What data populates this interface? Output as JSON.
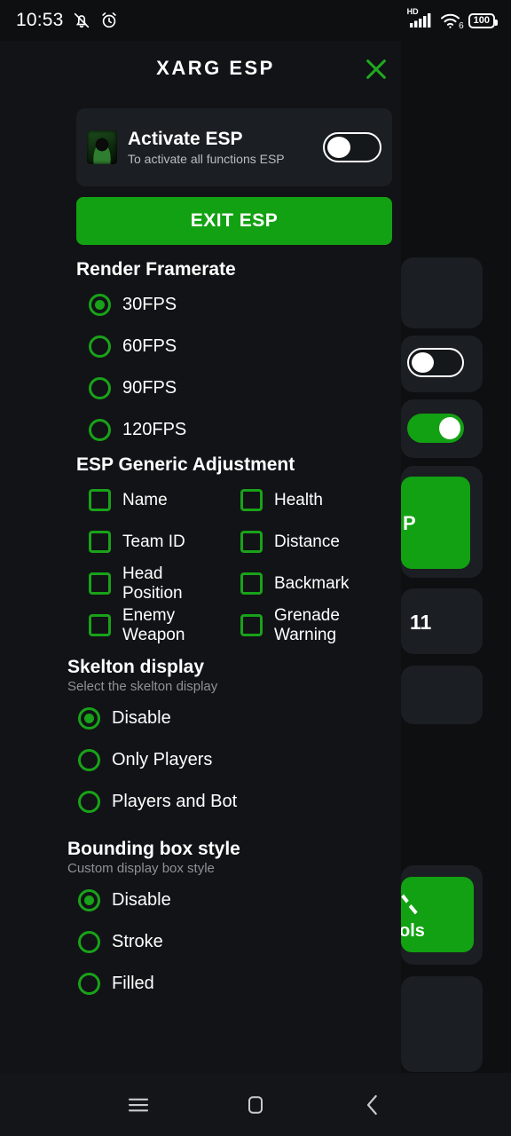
{
  "status_bar": {
    "time": "10:53",
    "icons_left": [
      "bell-muted-icon",
      "alarm-clock-icon"
    ],
    "network_label": "HD",
    "wifi_generation": "6",
    "battery_level": "100",
    "icons_right": [
      "hd-signal-icon",
      "wifi-6-icon",
      "battery-icon"
    ]
  },
  "theme": {
    "accent_green": "#12a112",
    "radio_green": "#19a219",
    "panel_bg": "#111316",
    "card_bg": "#1b1e22",
    "page_bg": "#0d0f11",
    "text_primary": "#ffffff",
    "text_secondary": "#8d9298"
  },
  "sidebar": {
    "items": [
      {
        "icon": "eye-icon",
        "active": true
      },
      {
        "icon": "location-pin-icon",
        "active": false
      },
      {
        "icon": "car-icon",
        "active": false
      },
      {
        "icon": "aim-target-icon",
        "active": false
      },
      {
        "icon": "gear-icon",
        "active": false
      },
      {
        "icon": "cpu-chip-icon",
        "active": false
      }
    ]
  },
  "panel": {
    "title": "XARG ESP",
    "close_icon": "close-icon",
    "activate_card": {
      "avatar_icon": "app-logo-avatar",
      "title": "Activate ESP",
      "subtitle": "To activate all functions ESP",
      "toggle_state": "off"
    },
    "exit_button": "EXIT ESP",
    "sections": [
      {
        "id": "render-framerate",
        "title": "Render Framerate",
        "subtitle": "",
        "type": "radio",
        "options": [
          {
            "label": "30FPS",
            "selected": true
          },
          {
            "label": "60FPS",
            "selected": false
          },
          {
            "label": "90FPS",
            "selected": false
          },
          {
            "label": "120FPS",
            "selected": false
          }
        ]
      },
      {
        "id": "esp-generic-adjustment",
        "title": "ESP Generic Adjustment",
        "subtitle": "",
        "type": "checkbox-grid",
        "options": [
          {
            "label": "Name",
            "checked": false
          },
          {
            "label": "Health",
            "checked": false
          },
          {
            "label": "Team ID",
            "checked": false
          },
          {
            "label": "Distance",
            "checked": false
          },
          {
            "label": "Head Position",
            "checked": false
          },
          {
            "label": "Backmark",
            "checked": false
          },
          {
            "label": "Enemy Weapon",
            "checked": false
          },
          {
            "label": "Grenade Warning",
            "checked": false
          }
        ]
      },
      {
        "id": "skelton-display",
        "title": "Skelton display",
        "subtitle": "Select the skelton display",
        "type": "radio",
        "options": [
          {
            "label": "Disable",
            "selected": true
          },
          {
            "label": "Only Players",
            "selected": false
          },
          {
            "label": "Players and Bot",
            "selected": false
          }
        ]
      },
      {
        "id": "bounding-box-style",
        "title": "Bounding box style",
        "subtitle": "Custom display box style",
        "type": "radio",
        "options": [
          {
            "label": "Disable",
            "selected": true
          },
          {
            "label": "Stroke",
            "selected": false
          },
          {
            "label": "Filled",
            "selected": false
          }
        ]
      }
    ]
  },
  "background_app": {
    "clipped_green_button_label": "P",
    "clipped_text": "11",
    "clipped_tools_label": "ols",
    "toggles": [
      {
        "state": "off"
      },
      {
        "state": "on"
      }
    ]
  },
  "nav_bar": {
    "items": [
      {
        "icon": "recents-icon"
      },
      {
        "icon": "home-icon"
      },
      {
        "icon": "back-icon"
      }
    ]
  }
}
